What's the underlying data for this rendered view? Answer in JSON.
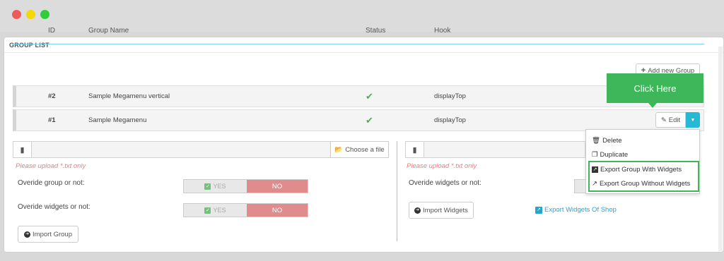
{
  "panel": {
    "heading": "GROUP LIST"
  },
  "table": {
    "headers": {
      "id": "ID",
      "name": "Group Name",
      "status": "Status",
      "hook": "Hook"
    },
    "add_button": "Add new Group",
    "rows": [
      {
        "id": "#2",
        "name": "Sample Megamenu vertical",
        "status_icon": "check-icon",
        "hook": "displayTop"
      },
      {
        "id": "#1",
        "name": "Sample Megamenu",
        "status_icon": "check-icon",
        "hook": "displayTop"
      }
    ],
    "edit_button": "Edit"
  },
  "callout": {
    "text": "Click Here"
  },
  "dropdown": {
    "items": [
      "Delete",
      "Duplicate",
      "Export Group With Widgets",
      "Export Group Without Widgets"
    ]
  },
  "left": {
    "choose_file": "Choose a file",
    "warning": "Please upload *.txt only",
    "overide_group_label": "Overide group or not:",
    "overide_widgets_label": "Overide widgets or not:",
    "yes": "YES",
    "no": "NO",
    "import_button": "Import Group"
  },
  "right": {
    "warning": "Please upload *.txt only",
    "overide_widgets_label": "Overide widgets or not:",
    "import_button": "Import Widgets",
    "export_link": "Export Widgets Of Shop"
  },
  "colors": {
    "accent": "#25b9d7",
    "callout_green": "#3db75a",
    "no_red": "#e08c8c"
  }
}
